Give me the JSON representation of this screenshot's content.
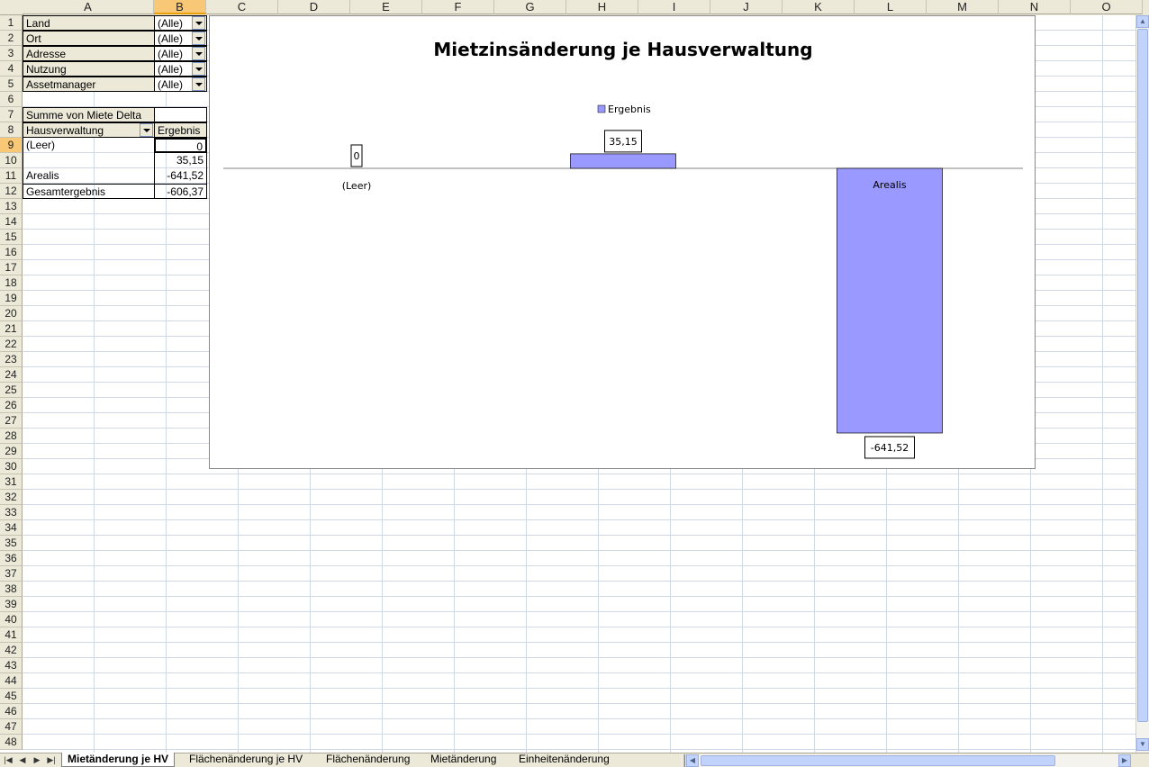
{
  "columns": [
    "A",
    "B",
    "C",
    "D",
    "E",
    "F",
    "G",
    "H",
    "I",
    "J",
    "K",
    "L",
    "M",
    "N",
    "O"
  ],
  "selected_column": "B",
  "rows": [
    "1",
    "2",
    "3",
    "4",
    "5",
    "6",
    "7",
    "8",
    "9",
    "10",
    "11",
    "12",
    "13",
    "14",
    "15",
    "16",
    "17",
    "18",
    "19",
    "20",
    "21",
    "22",
    "23",
    "24",
    "25",
    "26",
    "27",
    "28",
    "29",
    "30",
    "31",
    "32",
    "33",
    "34",
    "35",
    "36",
    "37",
    "38",
    "39",
    "40",
    "41",
    "42",
    "43",
    "44",
    "45",
    "46",
    "47",
    "48"
  ],
  "selected_row": "9",
  "filters": [
    {
      "label": "Land",
      "value": "(Alle)"
    },
    {
      "label": "Ort",
      "value": "(Alle)"
    },
    {
      "label": "Adresse",
      "value": "(Alle)"
    },
    {
      "label": "Nutzung",
      "value": "(Alle)"
    },
    {
      "label": "Assetmanager",
      "value": "(Alle)"
    }
  ],
  "pivot": {
    "data_field": "Summe von Miete Delta",
    "row_field": "Hausverwaltung",
    "result_header": "Ergebnis",
    "rows": [
      {
        "label": "(Leer)",
        "value": "0"
      },
      {
        "label": "",
        "value": "35,15"
      },
      {
        "label": "Arealis",
        "value": "-641,52"
      },
      {
        "label": "Gesamtergebnis",
        "value": "-606,37"
      }
    ]
  },
  "chart_data": {
    "type": "bar",
    "title": "Mietzinsänderung je Hausverwaltung",
    "categories": [
      "(Leer)",
      "",
      "Arealis"
    ],
    "series": [
      {
        "name": "Ergebnis",
        "values": [
          0,
          35.15,
          -641.52
        ],
        "color": "#9999ff"
      }
    ],
    "data_labels": [
      "0",
      "35,15",
      "-641,52"
    ],
    "legend": "top",
    "grid": false
  },
  "sheet_tabs": [
    {
      "label": "Mietänderung je HV",
      "active": true
    },
    {
      "label": "Flächenänderung je HV",
      "active": false
    },
    {
      "label": "Flächenänderung",
      "active": false
    },
    {
      "label": "Mietänderung",
      "active": false
    },
    {
      "label": "Einheitenänderung",
      "active": false
    }
  ],
  "nav_buttons": [
    "first-sheet",
    "prev-sheet",
    "next-sheet",
    "last-sheet"
  ],
  "colors": {
    "header_bg": "#ece9d8",
    "selected_header": "#f9c877",
    "grid": "#d0d7e5",
    "bar": "#9999ff"
  }
}
